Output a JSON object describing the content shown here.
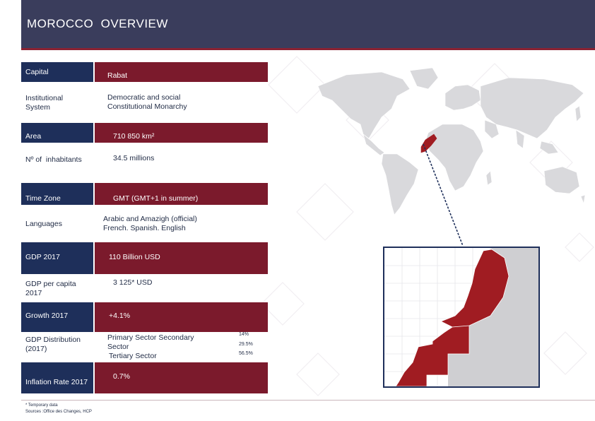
{
  "header": {
    "title": "MOROCCO  OVERVIEW"
  },
  "rows": [
    {
      "label": "Capital",
      "value": "Rabat"
    },
    {
      "label": "Institutional System",
      "value": "Democratic and social Constitutional Monarchy"
    },
    {
      "label": "Area",
      "value": "710 850 km²"
    },
    {
      "label": "Nº of  inhabitants",
      "value": "34.5 millions"
    },
    {
      "label": "Time Zone",
      "value": "GMT (GMT+1 in summer)"
    },
    {
      "label": "Languages",
      "value": "Arabic and Amazigh (official) French. Spanish. English"
    },
    {
      "label": "GDP 2017",
      "value": "110 Billion USD"
    },
    {
      "label": "GDP per capita 2017",
      "value": "3 125* USD"
    },
    {
      "label": "Growth 2017",
      "value": "+4.1%"
    },
    {
      "label": "GDP Distribution (2017)",
      "value_lines": [
        "Primary Sector  Secondary",
        "Sector",
        "Tertiary Sector"
      ]
    },
    {
      "label": "Inflation Rate 2017",
      "value": "0.7%"
    }
  ],
  "gdp_distribution_pct": [
    "14%",
    "29.5%",
    "56.5%"
  ],
  "footnote": {
    "line1": "* Temporary data",
    "line2": "Sources :Office des Changes, HCP"
  },
  "colors": {
    "header": "#3a3d5c",
    "label_dark": "#1e2f5a",
    "value_red": "#7b1a2c",
    "morocco": "#a01c22"
  },
  "icons": {
    "world_map": "world-map-icon",
    "morocco_map": "morocco-map-icon"
  }
}
